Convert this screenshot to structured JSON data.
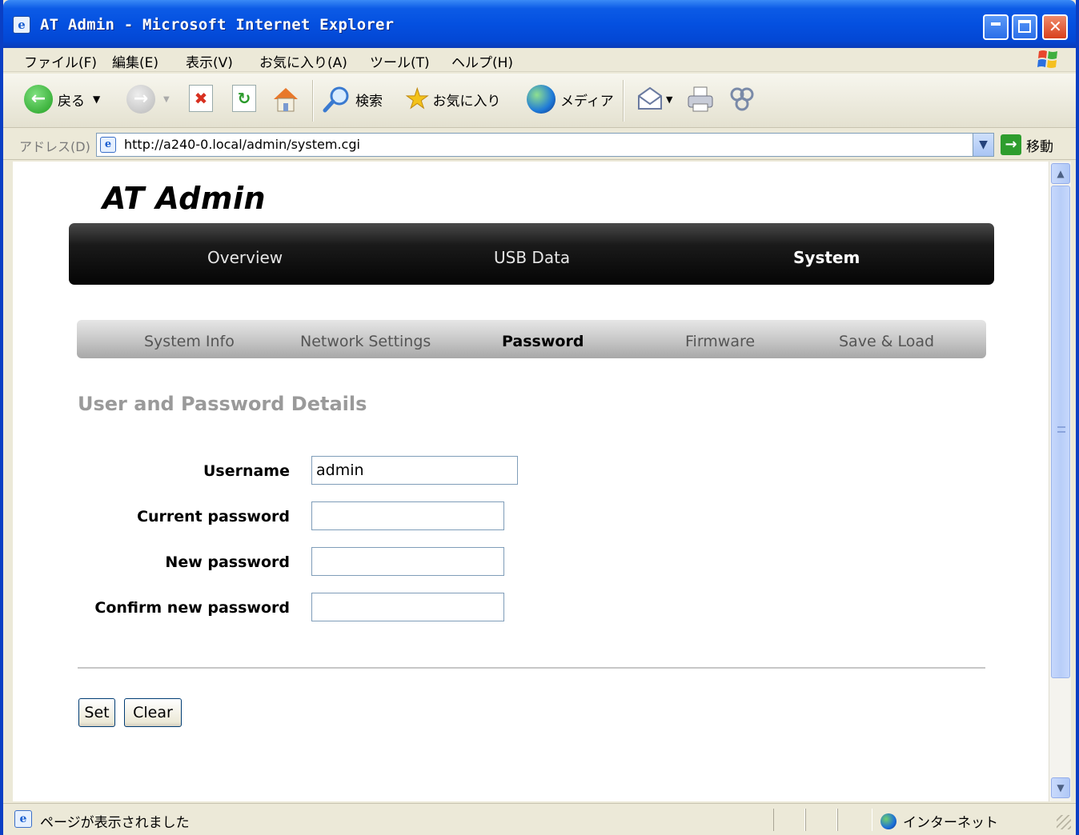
{
  "window": {
    "title": "AT Admin - Microsoft Internet Explorer"
  },
  "menubar": {
    "items": [
      "ファイル(F)",
      "編集(E)",
      "表示(V)",
      "お気に入り(A)",
      "ツール(T)",
      "ヘルプ(H)"
    ]
  },
  "toolbar": {
    "back_label": "戻る",
    "search_label": "検索",
    "favorites_label": "お気に入り",
    "media_label": "メディア"
  },
  "addressbar": {
    "label": "アドレス(D)",
    "url": "http://a240-0.local/admin/system.cgi",
    "go_label": "移動"
  },
  "page": {
    "logo": "AT Admin",
    "main_nav": [
      {
        "label": "Overview",
        "active": false
      },
      {
        "label": "USB Data",
        "active": false
      },
      {
        "label": "System",
        "active": true
      }
    ],
    "sub_nav": [
      {
        "label": "System Info",
        "active": false
      },
      {
        "label": "Network Settings",
        "active": false
      },
      {
        "label": "Password",
        "active": true
      },
      {
        "label": "Firmware",
        "active": false
      },
      {
        "label": "Save & Load",
        "active": false
      }
    ],
    "section_title": "User and Password Details",
    "form": {
      "username_label": "Username",
      "username_value": "admin",
      "current_password_label": "Current password",
      "current_password_value": "",
      "new_password_label": "New password",
      "new_password_value": "",
      "confirm_password_label": "Confirm new password",
      "confirm_password_value": ""
    },
    "buttons": {
      "set": "Set",
      "clear": "Clear"
    }
  },
  "statusbar": {
    "text": "ページが表示されました",
    "zone": "インターネット"
  },
  "colors": {
    "titlebar": "#0450e0",
    "main_nav_bg": "#050505",
    "sub_nav_bg": "#cfcfcf",
    "section_title": "#9a9a9a"
  }
}
